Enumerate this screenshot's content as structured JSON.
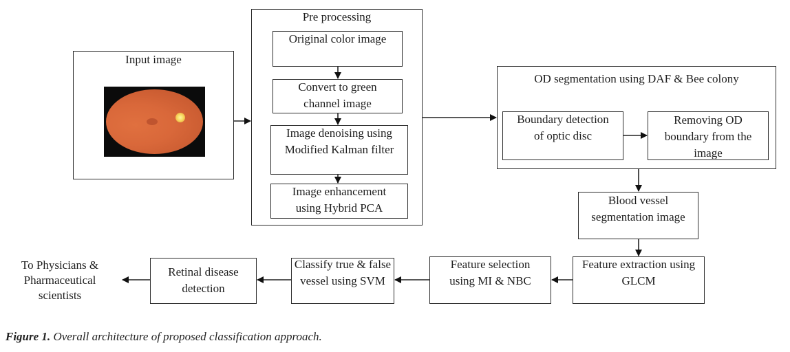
{
  "diagram": {
    "input": {
      "title": "Input image",
      "image": "retinal-fundus-photo"
    },
    "preprocessing": {
      "title": "Pre processing",
      "steps": [
        "Original color image",
        "Convert to green\nchannel image",
        "Image denoising using\nModified Kalman filter",
        "Image enhancement\nusing Hybrid PCA"
      ]
    },
    "od_segmentation": {
      "title": "OD segmentation using DAF & Bee colony",
      "steps": [
        "Boundary detection\nof optic disc",
        "Removing OD\nboundary from the\nimage"
      ]
    },
    "blood_vessel": "Blood vessel\nsegmentation image",
    "feature_extraction": "Feature extraction using\nGLCM",
    "feature_selection": "Feature selection\nusing MI & NBC",
    "classify": "Classify true & false\nvessel using SVM",
    "detection": "Retinal disease\ndetection",
    "output": "To Physicians &\nPharmaceutical\nscientists"
  },
  "caption": {
    "label": "Figure 1.",
    "text": " Overall architecture of proposed classification approach."
  }
}
